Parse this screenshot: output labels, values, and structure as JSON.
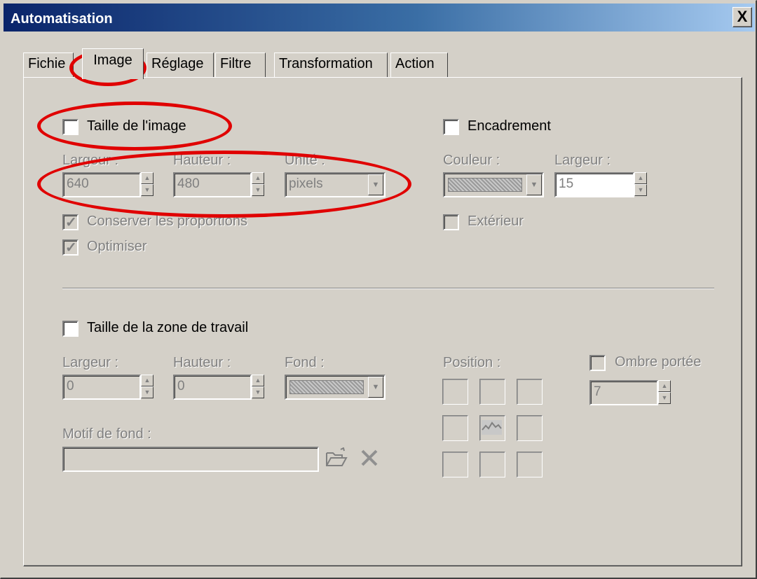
{
  "window": {
    "title": "Automatisation",
    "close_glyph": "X"
  },
  "tabs": [
    {
      "label": "Fichie",
      "active": false
    },
    {
      "label": "Image",
      "active": true
    },
    {
      "label": "Réglage",
      "active": false
    },
    {
      "label": "Filtre",
      "active": false
    },
    {
      "label": "Transformation",
      "active": false
    },
    {
      "label": "Action",
      "active": false
    }
  ],
  "image_size": {
    "checkbox_label": "Taille de l'image",
    "checked": false,
    "width_label": "Largeur :",
    "width_value": "640",
    "height_label": "Hauteur :",
    "height_value": "480",
    "unit_label": "Unité :",
    "unit_value": "pixels",
    "keep_proportions_label": "Conserver les proportions",
    "keep_proportions_checked": true,
    "optimize_label": "Optimiser",
    "optimize_checked": true
  },
  "frame": {
    "checkbox_label": "Encadrement",
    "checked": false,
    "color_label": "Couleur :",
    "width_label": "Largeur :",
    "width_value": "15",
    "exterior_label": "Extérieur",
    "exterior_checked": false
  },
  "workspace": {
    "checkbox_label": "Taille de la zone de travail",
    "checked": false,
    "width_label": "Largeur :",
    "width_value": "0",
    "height_label": "Hauteur :",
    "height_value": "0",
    "background_label": "Fond :",
    "pattern_label": "Motif de fond :",
    "pattern_value": "",
    "position_label": "Position :",
    "shadow_label": "Ombre portée",
    "shadow_checked": false,
    "shadow_value": "7"
  },
  "icons": {
    "browse": "folder-open-icon",
    "clear": "delete-x-icon"
  },
  "colors": {
    "annotation": "#e00000",
    "title_start": "#0a246a",
    "title_end": "#a6caf0",
    "face": "#d4d0c8"
  }
}
